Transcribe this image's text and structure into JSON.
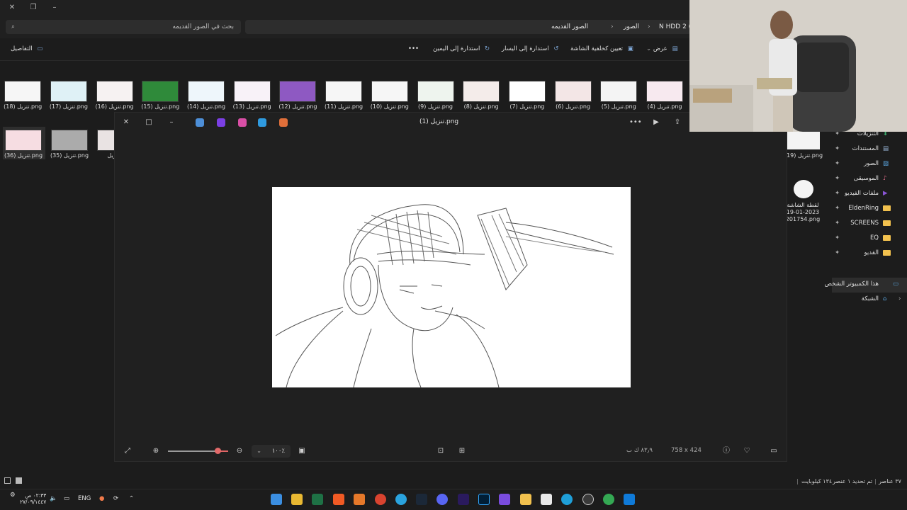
{
  "explorer": {
    "search_placeholder": "بحث في الصور القديمه",
    "breadcrumbs": [
      "N HDD 2 (",
      "الصور",
      "الصور القديمه"
    ],
    "toolbar": {
      "view_label": "عرض",
      "set_wallpaper_label": "تعيين كخلفية الشاشة",
      "rotate_left_label": "استدارة إلى اليسار",
      "rotate_right_label": "استدارة إلى اليمين",
      "more_label": "•••",
      "details_label": "التفاصيل"
    },
    "thumbnails_row1": [
      "تنزيل (4).png",
      "تنزيل (5).png",
      "تنزيل (6).png",
      "تنزيل (7).png",
      "تنزيل (8).png",
      "تنزيل (9).png",
      "تنزيل (10).png",
      "تنزيل (11).png",
      "تنزيل (12).png",
      "تنزيل (13).png",
      "تنزيل (14).png",
      "تنزيل (15).png",
      "تنزيل (16).png",
      "تنزيل (17).png",
      "تنزيل (18).png"
    ],
    "thumbnails_row2": [
      "تنزيل (36).png",
      "تنزيل (35).png",
      "تنزيل ("
    ],
    "right_files": [
      {
        "label": "تنزيل (19).png"
      },
      {
        "label": "لقطة الشاشة 2023-01-19 201754.png"
      }
    ],
    "nav_pane": [
      {
        "label": "التنزيلات",
        "icon": "download-icon"
      },
      {
        "label": "المستندات",
        "icon": "document-icon"
      },
      {
        "label": "الصور",
        "icon": "pictures-icon"
      },
      {
        "label": "الموسيقى",
        "icon": "music-icon"
      },
      {
        "label": "ملفات الفيديو",
        "icon": "video-icon"
      },
      {
        "label": "EldenRing",
        "icon": "folder-icon"
      },
      {
        "label": "SCREENS",
        "icon": "folder-icon"
      },
      {
        "label": "EQ",
        "icon": "folder-icon"
      },
      {
        "label": "القديو",
        "icon": "folder-icon"
      },
      {
        "label": "هذا الكمبيوتر الشخص",
        "icon": "pc-icon"
      },
      {
        "label": "الشبكة",
        "icon": "network-icon"
      }
    ],
    "status": {
      "item_count": "٣٧ عناصر",
      "selection": "تم تحديد ١ عنصر",
      "size": "١٣٤ كيلوبايت"
    }
  },
  "viewer": {
    "title": "تنزيل (1).png",
    "zoom_value": "١٠٠٪",
    "dimensions": "758 x 424",
    "file_size": "٨٣٫٩ ك ب",
    "zoom_level_fraction": 0.82
  },
  "taskbar": {
    "lang": "ENG",
    "time": "٠٢:٣٣ ص",
    "date": "٢٧/٠٩/١٤٤٧"
  },
  "colors": {
    "accent_red": "#e36a6a",
    "folder_yellow": "#f2c14e",
    "bg_dark": "#1c1c1c"
  }
}
